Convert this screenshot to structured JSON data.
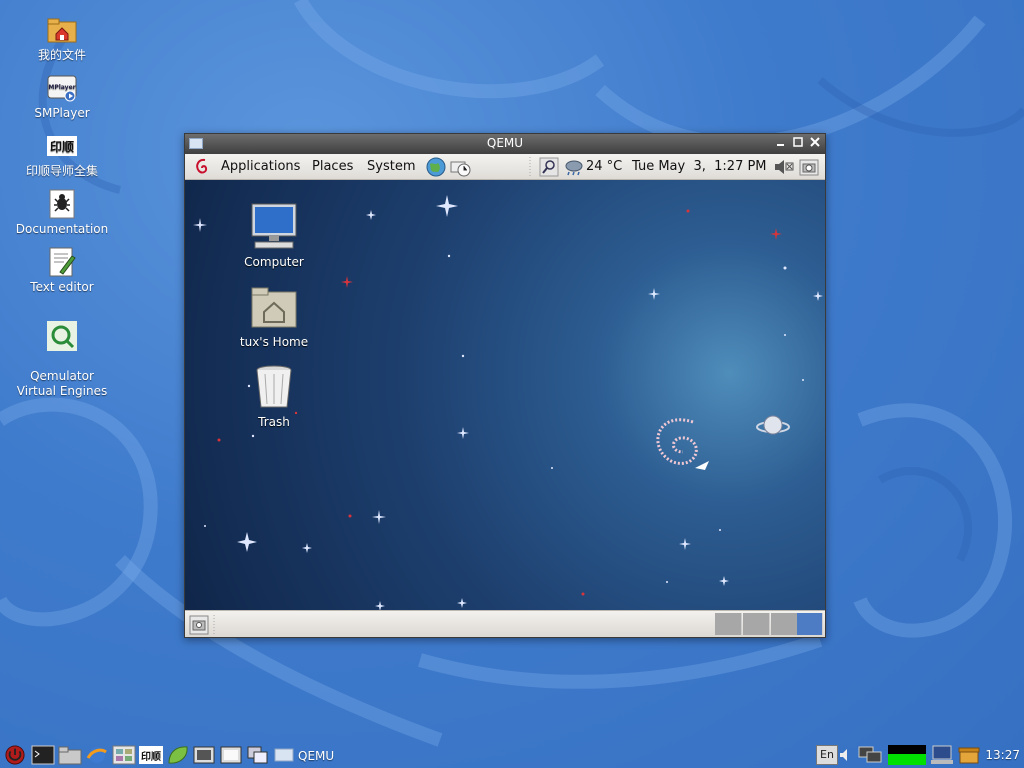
{
  "host_desktop": {
    "icons": [
      {
        "label": "我的文件",
        "icon": "home-folder-icon"
      },
      {
        "label": "SMPlayer",
        "icon": "smplayer-icon"
      },
      {
        "label": "印顺导师全集",
        "icon": "book-collection-icon"
      },
      {
        "label": "Documentation",
        "icon": "documentation-icon"
      },
      {
        "label": "Text editor",
        "icon": "text-editor-icon"
      },
      {
        "label": "Qemulator\nVirtual Engines",
        "icon": "qemulator-icon"
      }
    ],
    "smplayer_badge": "MPlayer",
    "book_badge": "印顺"
  },
  "qemu_window": {
    "title": "QEMU",
    "controls": [
      "minimize",
      "maximize",
      "close"
    ]
  },
  "guest": {
    "top_panel": {
      "menus": [
        "Applications",
        "Places",
        "System"
      ],
      "weather": "24 °C",
      "datetime": "Tue May  3,  1:27 PM"
    },
    "desktop_icons": [
      {
        "label": "Computer"
      },
      {
        "label": "tux's Home"
      },
      {
        "label": "Trash"
      }
    ],
    "workspaces": 4,
    "active_workspace": 4
  },
  "host_taskbar": {
    "tasks": [
      {
        "label": "QEMU"
      }
    ],
    "keyboard_layout": "En",
    "book_badge": "印顺",
    "clock": "13:27"
  },
  "colors": {
    "host_bg": "#3f7bcc",
    "guest_panel": "#e8e6e2",
    "cpu_graph": "#00e000",
    "active_workspace": "#4d7cc4"
  }
}
